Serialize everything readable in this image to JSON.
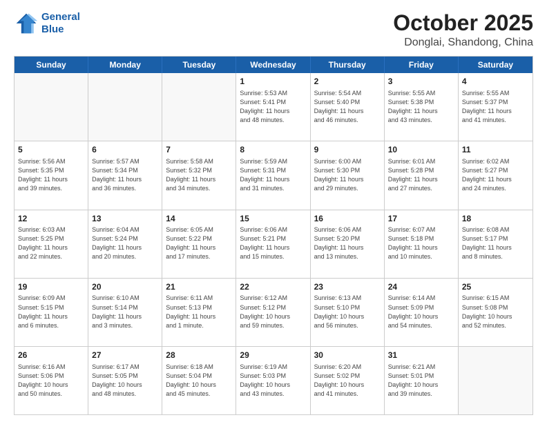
{
  "logo": {
    "line1": "General",
    "line2": "Blue"
  },
  "title": "October 2025",
  "location": "Donglai, Shandong, China",
  "weekdays": [
    "Sunday",
    "Monday",
    "Tuesday",
    "Wednesday",
    "Thursday",
    "Friday",
    "Saturday"
  ],
  "rows": [
    [
      {
        "day": "",
        "info": ""
      },
      {
        "day": "",
        "info": ""
      },
      {
        "day": "",
        "info": ""
      },
      {
        "day": "1",
        "info": "Sunrise: 5:53 AM\nSunset: 5:41 PM\nDaylight: 11 hours\nand 48 minutes."
      },
      {
        "day": "2",
        "info": "Sunrise: 5:54 AM\nSunset: 5:40 PM\nDaylight: 11 hours\nand 46 minutes."
      },
      {
        "day": "3",
        "info": "Sunrise: 5:55 AM\nSunset: 5:38 PM\nDaylight: 11 hours\nand 43 minutes."
      },
      {
        "day": "4",
        "info": "Sunrise: 5:55 AM\nSunset: 5:37 PM\nDaylight: 11 hours\nand 41 minutes."
      }
    ],
    [
      {
        "day": "5",
        "info": "Sunrise: 5:56 AM\nSunset: 5:35 PM\nDaylight: 11 hours\nand 39 minutes."
      },
      {
        "day": "6",
        "info": "Sunrise: 5:57 AM\nSunset: 5:34 PM\nDaylight: 11 hours\nand 36 minutes."
      },
      {
        "day": "7",
        "info": "Sunrise: 5:58 AM\nSunset: 5:32 PM\nDaylight: 11 hours\nand 34 minutes."
      },
      {
        "day": "8",
        "info": "Sunrise: 5:59 AM\nSunset: 5:31 PM\nDaylight: 11 hours\nand 31 minutes."
      },
      {
        "day": "9",
        "info": "Sunrise: 6:00 AM\nSunset: 5:30 PM\nDaylight: 11 hours\nand 29 minutes."
      },
      {
        "day": "10",
        "info": "Sunrise: 6:01 AM\nSunset: 5:28 PM\nDaylight: 11 hours\nand 27 minutes."
      },
      {
        "day": "11",
        "info": "Sunrise: 6:02 AM\nSunset: 5:27 PM\nDaylight: 11 hours\nand 24 minutes."
      }
    ],
    [
      {
        "day": "12",
        "info": "Sunrise: 6:03 AM\nSunset: 5:25 PM\nDaylight: 11 hours\nand 22 minutes."
      },
      {
        "day": "13",
        "info": "Sunrise: 6:04 AM\nSunset: 5:24 PM\nDaylight: 11 hours\nand 20 minutes."
      },
      {
        "day": "14",
        "info": "Sunrise: 6:05 AM\nSunset: 5:22 PM\nDaylight: 11 hours\nand 17 minutes."
      },
      {
        "day": "15",
        "info": "Sunrise: 6:06 AM\nSunset: 5:21 PM\nDaylight: 11 hours\nand 15 minutes."
      },
      {
        "day": "16",
        "info": "Sunrise: 6:06 AM\nSunset: 5:20 PM\nDaylight: 11 hours\nand 13 minutes."
      },
      {
        "day": "17",
        "info": "Sunrise: 6:07 AM\nSunset: 5:18 PM\nDaylight: 11 hours\nand 10 minutes."
      },
      {
        "day": "18",
        "info": "Sunrise: 6:08 AM\nSunset: 5:17 PM\nDaylight: 11 hours\nand 8 minutes."
      }
    ],
    [
      {
        "day": "19",
        "info": "Sunrise: 6:09 AM\nSunset: 5:15 PM\nDaylight: 11 hours\nand 6 minutes."
      },
      {
        "day": "20",
        "info": "Sunrise: 6:10 AM\nSunset: 5:14 PM\nDaylight: 11 hours\nand 3 minutes."
      },
      {
        "day": "21",
        "info": "Sunrise: 6:11 AM\nSunset: 5:13 PM\nDaylight: 11 hours\nand 1 minute."
      },
      {
        "day": "22",
        "info": "Sunrise: 6:12 AM\nSunset: 5:12 PM\nDaylight: 10 hours\nand 59 minutes."
      },
      {
        "day": "23",
        "info": "Sunrise: 6:13 AM\nSunset: 5:10 PM\nDaylight: 10 hours\nand 56 minutes."
      },
      {
        "day": "24",
        "info": "Sunrise: 6:14 AM\nSunset: 5:09 PM\nDaylight: 10 hours\nand 54 minutes."
      },
      {
        "day": "25",
        "info": "Sunrise: 6:15 AM\nSunset: 5:08 PM\nDaylight: 10 hours\nand 52 minutes."
      }
    ],
    [
      {
        "day": "26",
        "info": "Sunrise: 6:16 AM\nSunset: 5:06 PM\nDaylight: 10 hours\nand 50 minutes."
      },
      {
        "day": "27",
        "info": "Sunrise: 6:17 AM\nSunset: 5:05 PM\nDaylight: 10 hours\nand 48 minutes."
      },
      {
        "day": "28",
        "info": "Sunrise: 6:18 AM\nSunset: 5:04 PM\nDaylight: 10 hours\nand 45 minutes."
      },
      {
        "day": "29",
        "info": "Sunrise: 6:19 AM\nSunset: 5:03 PM\nDaylight: 10 hours\nand 43 minutes."
      },
      {
        "day": "30",
        "info": "Sunrise: 6:20 AM\nSunset: 5:02 PM\nDaylight: 10 hours\nand 41 minutes."
      },
      {
        "day": "31",
        "info": "Sunrise: 6:21 AM\nSunset: 5:01 PM\nDaylight: 10 hours\nand 39 minutes."
      },
      {
        "day": "",
        "info": ""
      }
    ]
  ]
}
